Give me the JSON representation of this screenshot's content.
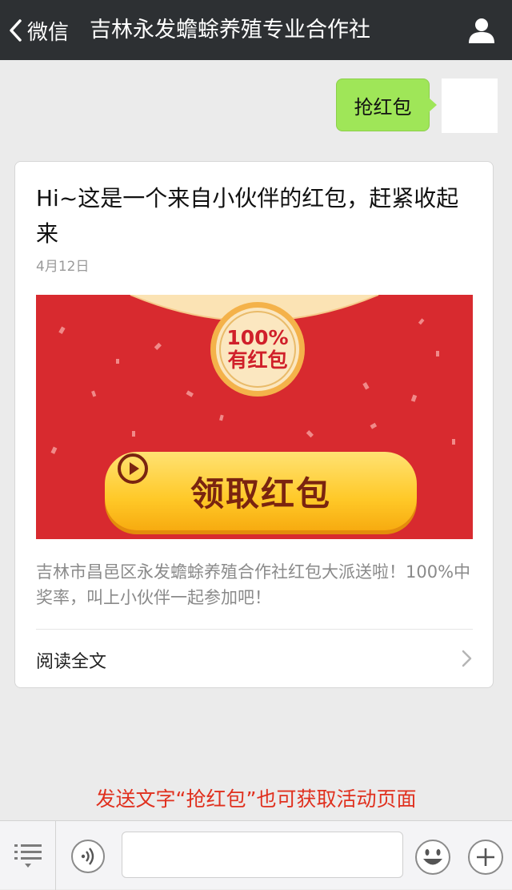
{
  "header": {
    "back_label": "微信",
    "title": "吉林永发蟾蜍养殖专业合作社"
  },
  "chat": {
    "sent_message": "抢红包"
  },
  "article": {
    "title": "Hi~这是一个来自小伙伴的红包，赶紧收起来",
    "date": "4月12日",
    "cover": {
      "badge_line1": "100%",
      "badge_line2": "有红包",
      "button_label": "领取红包"
    },
    "description": "吉林市昌邑区永发蟾蜍养殖合作社红包大派送啦！100%中奖率，叫上小伙伴一起参加吧！",
    "read_more": "阅读全文"
  },
  "notice": "发送文字“抢红包”也可获取活动页面",
  "input_bar": {
    "value": ""
  },
  "colors": {
    "header_bg": "#2d3033",
    "bubble_green": "#9fe658",
    "envelope_red": "#d82a2f",
    "button_gold": "#ffc928",
    "notice_red": "#e0301e"
  },
  "icons": [
    "chevron-left-icon",
    "person-icon",
    "play-icon",
    "chevron-right-icon",
    "menu-icon",
    "voice-icon",
    "emoji-icon",
    "plus-icon"
  ]
}
